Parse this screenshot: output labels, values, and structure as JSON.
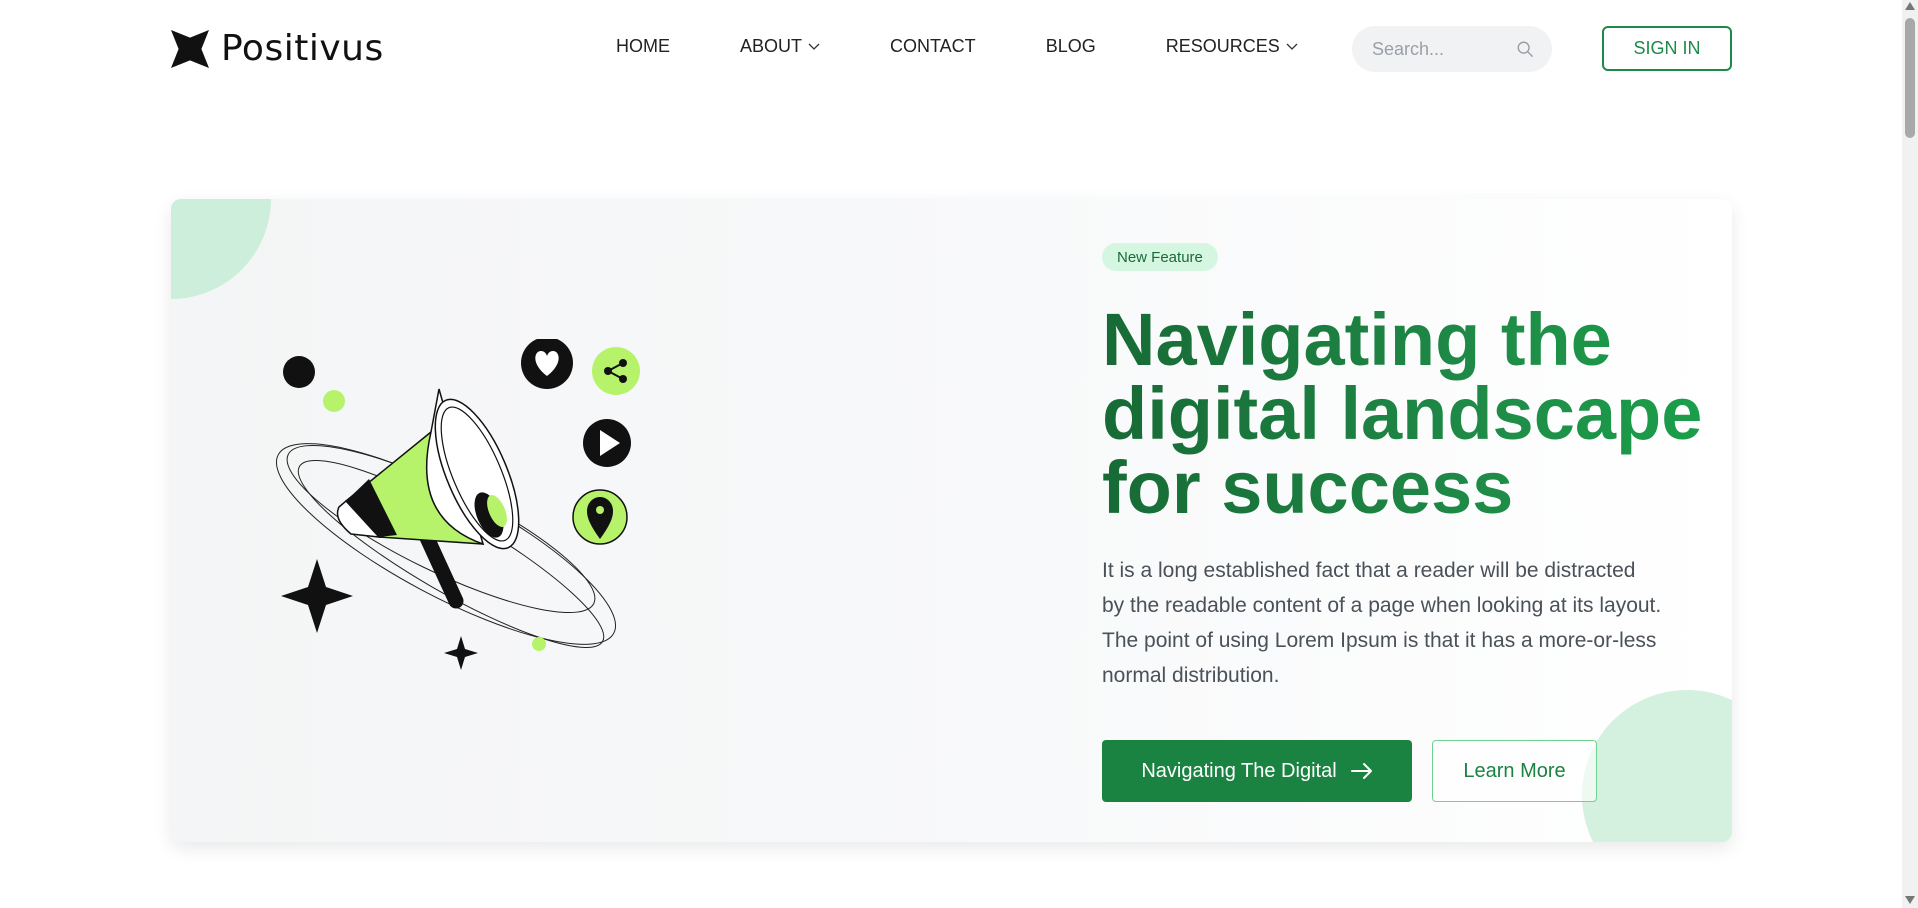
{
  "brand": {
    "name": "Positivus"
  },
  "nav": {
    "home": "HOME",
    "about": "ABOUT",
    "contact": "CONTACT",
    "blog": "BLOG",
    "resources": "RESOURCES"
  },
  "search": {
    "placeholder": "Search..."
  },
  "header": {
    "signin_label": "SIGN IN"
  },
  "hero": {
    "badge": "New Feature",
    "headline": "Navigating the digital landscape for success",
    "description": "It is a long established fact that a reader will be distracted by the readable content of a page when looking at its layout. The point of using Lorem Ipsum is that it has a more-or-less normal distribution.",
    "primary_cta": "Navigating The Digital",
    "secondary_cta": "Learn More"
  },
  "illustration": {
    "icons": [
      "megaphone-icon",
      "heart-icon",
      "share-icon",
      "play-icon",
      "location-pin-icon",
      "sparkle-icon"
    ]
  },
  "colors": {
    "accent": "#1b8342",
    "accent_light": "#d5f6e0",
    "lime": "#b6f36a",
    "text": "#4a5159"
  }
}
